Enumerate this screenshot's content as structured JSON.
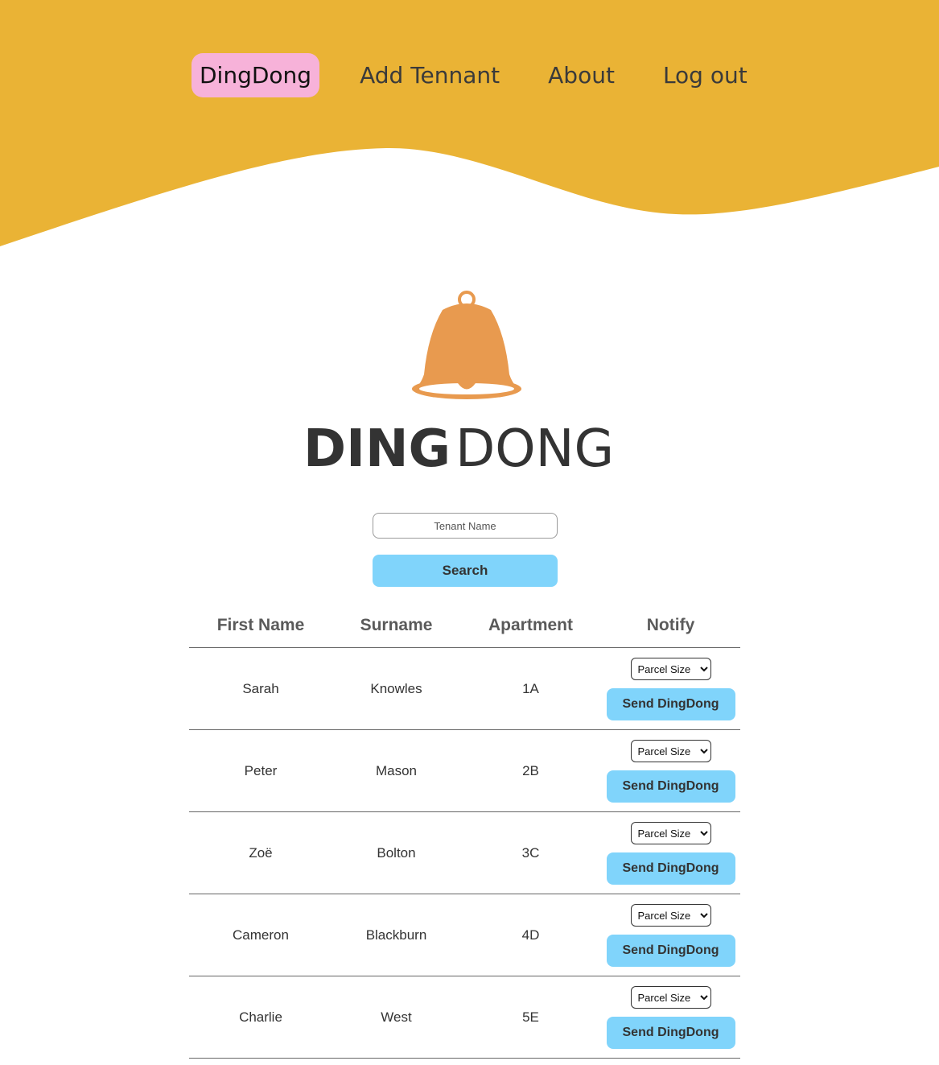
{
  "colors": {
    "header": "#eab335",
    "nav_active": "#f7b2d9",
    "button": "#80d4fb",
    "bell": "#e89a4f"
  },
  "nav": {
    "home": "DingDong",
    "add_tenant": "Add Tennant",
    "about": "About",
    "logout": "Log out"
  },
  "logo": {
    "icon": "bell-icon",
    "word_bold": "DING",
    "word_light": "DONG"
  },
  "search": {
    "placeholder": "Tenant Name",
    "button_label": "Search"
  },
  "table": {
    "headers": [
      "First Name",
      "Surname",
      "Apartment",
      "Notify"
    ],
    "rows": [
      {
        "first": "Sarah",
        "surname": "Knowles",
        "apartment": "1A"
      },
      {
        "first": "Peter",
        "surname": "Mason",
        "apartment": "2B"
      },
      {
        "first": "Zoë",
        "surname": "Bolton",
        "apartment": "3C"
      },
      {
        "first": "Cameron",
        "surname": "Blackburn",
        "apartment": "4D"
      },
      {
        "first": "Charlie",
        "surname": "West",
        "apartment": "5E"
      }
    ],
    "select_value": "Parcel Size",
    "send_label": "Send DingDong"
  }
}
